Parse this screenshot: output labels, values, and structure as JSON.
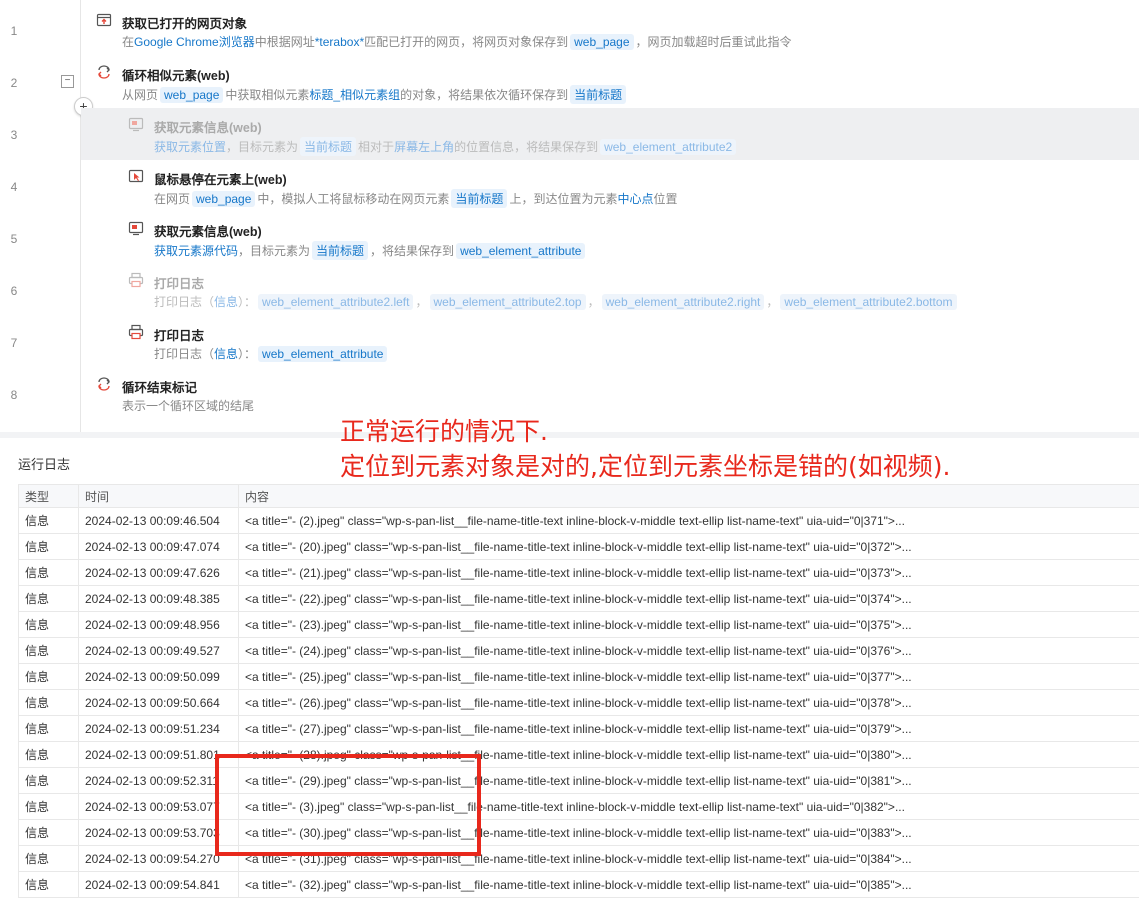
{
  "steps": [
    {
      "line": "1",
      "title": "获取已打开的网页对象",
      "desc": [
        {
          "t": "text",
          "v": "在"
        },
        {
          "t": "lnk",
          "v": "Google Chrome浏览器"
        },
        {
          "t": "text",
          "v": "中根据网址"
        },
        {
          "t": "lnk",
          "v": "*terabox*"
        },
        {
          "t": "text",
          "v": "匹配已打开的网页，将网页对象保存到"
        },
        {
          "t": "tag",
          "v": "web_page"
        },
        {
          "t": "text",
          "v": "，网页加载超时后重试此指令"
        }
      ]
    },
    {
      "line": "2",
      "title": "循环相似元素(web)",
      "desc": [
        {
          "t": "text",
          "v": "从网页"
        },
        {
          "t": "tag",
          "v": "web_page"
        },
        {
          "t": "text",
          "v": "中获取相似元素"
        },
        {
          "t": "lnk",
          "v": "标题_相似元素组"
        },
        {
          "t": "text",
          "v": "的对象，将结果依次循环保存到"
        },
        {
          "t": "tag",
          "v": "当前标题"
        }
      ]
    },
    {
      "line": "3",
      "title": "获取元素信息(web)",
      "desc": [
        {
          "t": "lnk",
          "v": "获取元素位置"
        },
        {
          "t": "text",
          "v": "，目标元素为"
        },
        {
          "t": "tag",
          "v": "当前标题"
        },
        {
          "t": "text",
          "v": "相对于"
        },
        {
          "t": "lnk",
          "v": "屏幕左上角"
        },
        {
          "t": "text",
          "v": "的位置信息，将结果保存到"
        },
        {
          "t": "tag",
          "v": "web_element_attribute2"
        }
      ]
    },
    {
      "line": "4",
      "title": "鼠标悬停在元素上(web)",
      "desc": [
        {
          "t": "text",
          "v": "在网页"
        },
        {
          "t": "tag",
          "v": "web_page"
        },
        {
          "t": "text",
          "v": "中，模拟人工将鼠标移动在网页元素"
        },
        {
          "t": "tag",
          "v": "当前标题"
        },
        {
          "t": "text",
          "v": "上，到达位置为元素"
        },
        {
          "t": "lnk",
          "v": "中心点"
        },
        {
          "t": "text",
          "v": "位置"
        }
      ]
    },
    {
      "line": "5",
      "title": "获取元素信息(web)",
      "desc": [
        {
          "t": "lnk",
          "v": "获取元素源代码"
        },
        {
          "t": "text",
          "v": "，目标元素为"
        },
        {
          "t": "tag",
          "v": "当前标题"
        },
        {
          "t": "text",
          "v": "，将结果保存到"
        },
        {
          "t": "tag",
          "v": "web_element_attribute"
        }
      ]
    },
    {
      "line": "6",
      "title": "打印日志",
      "desc": [
        {
          "t": "text",
          "v": "打印日志（"
        },
        {
          "t": "lnk",
          "v": "信息"
        },
        {
          "t": "text",
          "v": "）："
        },
        {
          "t": "tag",
          "v": "web_element_attribute2.left"
        },
        {
          "t": "text",
          "v": "，"
        },
        {
          "t": "tag",
          "v": "web_element_attribute2.top"
        },
        {
          "t": "text",
          "v": "，"
        },
        {
          "t": "tag",
          "v": "web_element_attribute2.right"
        },
        {
          "t": "text",
          "v": "，"
        },
        {
          "t": "tag",
          "v": "web_element_attribute2.bottom"
        }
      ]
    },
    {
      "line": "7",
      "title": "打印日志",
      "desc": [
        {
          "t": "text",
          "v": "打印日志（"
        },
        {
          "t": "lnk",
          "v": "信息"
        },
        {
          "t": "text",
          "v": "）："
        },
        {
          "t": "tag",
          "v": "web_element_attribute"
        }
      ]
    },
    {
      "line": "8",
      "title": "循环结束标记",
      "desc": [
        {
          "t": "text",
          "v": "表示一个循环区域的结尾"
        }
      ]
    }
  ],
  "controls": {
    "collapse": "−",
    "add": "+"
  },
  "annotation": {
    "line1": "正常运行的情况下.",
    "line2": "定位到元素对象是对的,定位到元素坐标是错的(如视频)."
  },
  "log": {
    "title": "运行日志",
    "columns": [
      "类型",
      "时间",
      "内容"
    ],
    "rows": [
      [
        "信息",
        "2024-02-13 00:09:46.504",
        "<a title=\"- (2).jpeg\" class=\"wp-s-pan-list__file-name-title-text inline-block-v-middle text-ellip list-name-text\" uia-uid=\"0|371\">..."
      ],
      [
        "信息",
        "2024-02-13 00:09:47.074",
        "<a title=\"- (20).jpeg\" class=\"wp-s-pan-list__file-name-title-text inline-block-v-middle text-ellip list-name-text\" uia-uid=\"0|372\">..."
      ],
      [
        "信息",
        "2024-02-13 00:09:47.626",
        "<a title=\"- (21).jpeg\" class=\"wp-s-pan-list__file-name-title-text inline-block-v-middle text-ellip list-name-text\" uia-uid=\"0|373\">..."
      ],
      [
        "信息",
        "2024-02-13 00:09:48.385",
        "<a title=\"- (22).jpeg\" class=\"wp-s-pan-list__file-name-title-text inline-block-v-middle text-ellip list-name-text\" uia-uid=\"0|374\">..."
      ],
      [
        "信息",
        "2024-02-13 00:09:48.956",
        "<a title=\"- (23).jpeg\" class=\"wp-s-pan-list__file-name-title-text inline-block-v-middle text-ellip list-name-text\" uia-uid=\"0|375\">..."
      ],
      [
        "信息",
        "2024-02-13 00:09:49.527",
        "<a title=\"- (24).jpeg\" class=\"wp-s-pan-list__file-name-title-text inline-block-v-middle text-ellip list-name-text\" uia-uid=\"0|376\">..."
      ],
      [
        "信息",
        "2024-02-13 00:09:50.099",
        "<a title=\"- (25).jpeg\" class=\"wp-s-pan-list__file-name-title-text inline-block-v-middle text-ellip list-name-text\" uia-uid=\"0|377\">..."
      ],
      [
        "信息",
        "2024-02-13 00:09:50.664",
        "<a title=\"- (26).jpeg\" class=\"wp-s-pan-list__file-name-title-text inline-block-v-middle text-ellip list-name-text\" uia-uid=\"0|378\">..."
      ],
      [
        "信息",
        "2024-02-13 00:09:51.234",
        "<a title=\"- (27).jpeg\" class=\"wp-s-pan-list__file-name-title-text inline-block-v-middle text-ellip list-name-text\" uia-uid=\"0|379\">..."
      ],
      [
        "信息",
        "2024-02-13 00:09:51.801",
        "<a title=\"- (28).jpeg\" class=\"wp-s-pan-list__file-name-title-text inline-block-v-middle text-ellip list-name-text\" uia-uid=\"0|380\">..."
      ],
      [
        "信息",
        "2024-02-13 00:09:52.311",
        "<a title=\"- (29).jpeg\" class=\"wp-s-pan-list__file-name-title-text inline-block-v-middle text-ellip list-name-text\" uia-uid=\"0|381\">..."
      ],
      [
        "信息",
        "2024-02-13 00:09:53.077",
        "<a title=\"- (3).jpeg\" class=\"wp-s-pan-list__file-name-title-text inline-block-v-middle text-ellip list-name-text\" uia-uid=\"0|382\">..."
      ],
      [
        "信息",
        "2024-02-13 00:09:53.703",
        "<a title=\"- (30).jpeg\" class=\"wp-s-pan-list__file-name-title-text inline-block-v-middle text-ellip list-name-text\" uia-uid=\"0|383\">..."
      ],
      [
        "信息",
        "2024-02-13 00:09:54.270",
        "<a title=\"- (31).jpeg\" class=\"wp-s-pan-list__file-name-title-text inline-block-v-middle text-ellip list-name-text\" uia-uid=\"0|384\">..."
      ],
      [
        "信息",
        "2024-02-13 00:09:54.841",
        "<a title=\"- (32).jpeg\" class=\"wp-s-pan-list__file-name-title-text inline-block-v-middle text-ellip list-name-text\" uia-uid=\"0|385\">..."
      ]
    ]
  },
  "icons": [
    "browser-open-icon",
    "loop-icon",
    "element-info-icon",
    "mouse-hover-icon",
    "element-info-icon",
    "print-log-icon",
    "print-log-icon",
    "loop-end-icon"
  ]
}
